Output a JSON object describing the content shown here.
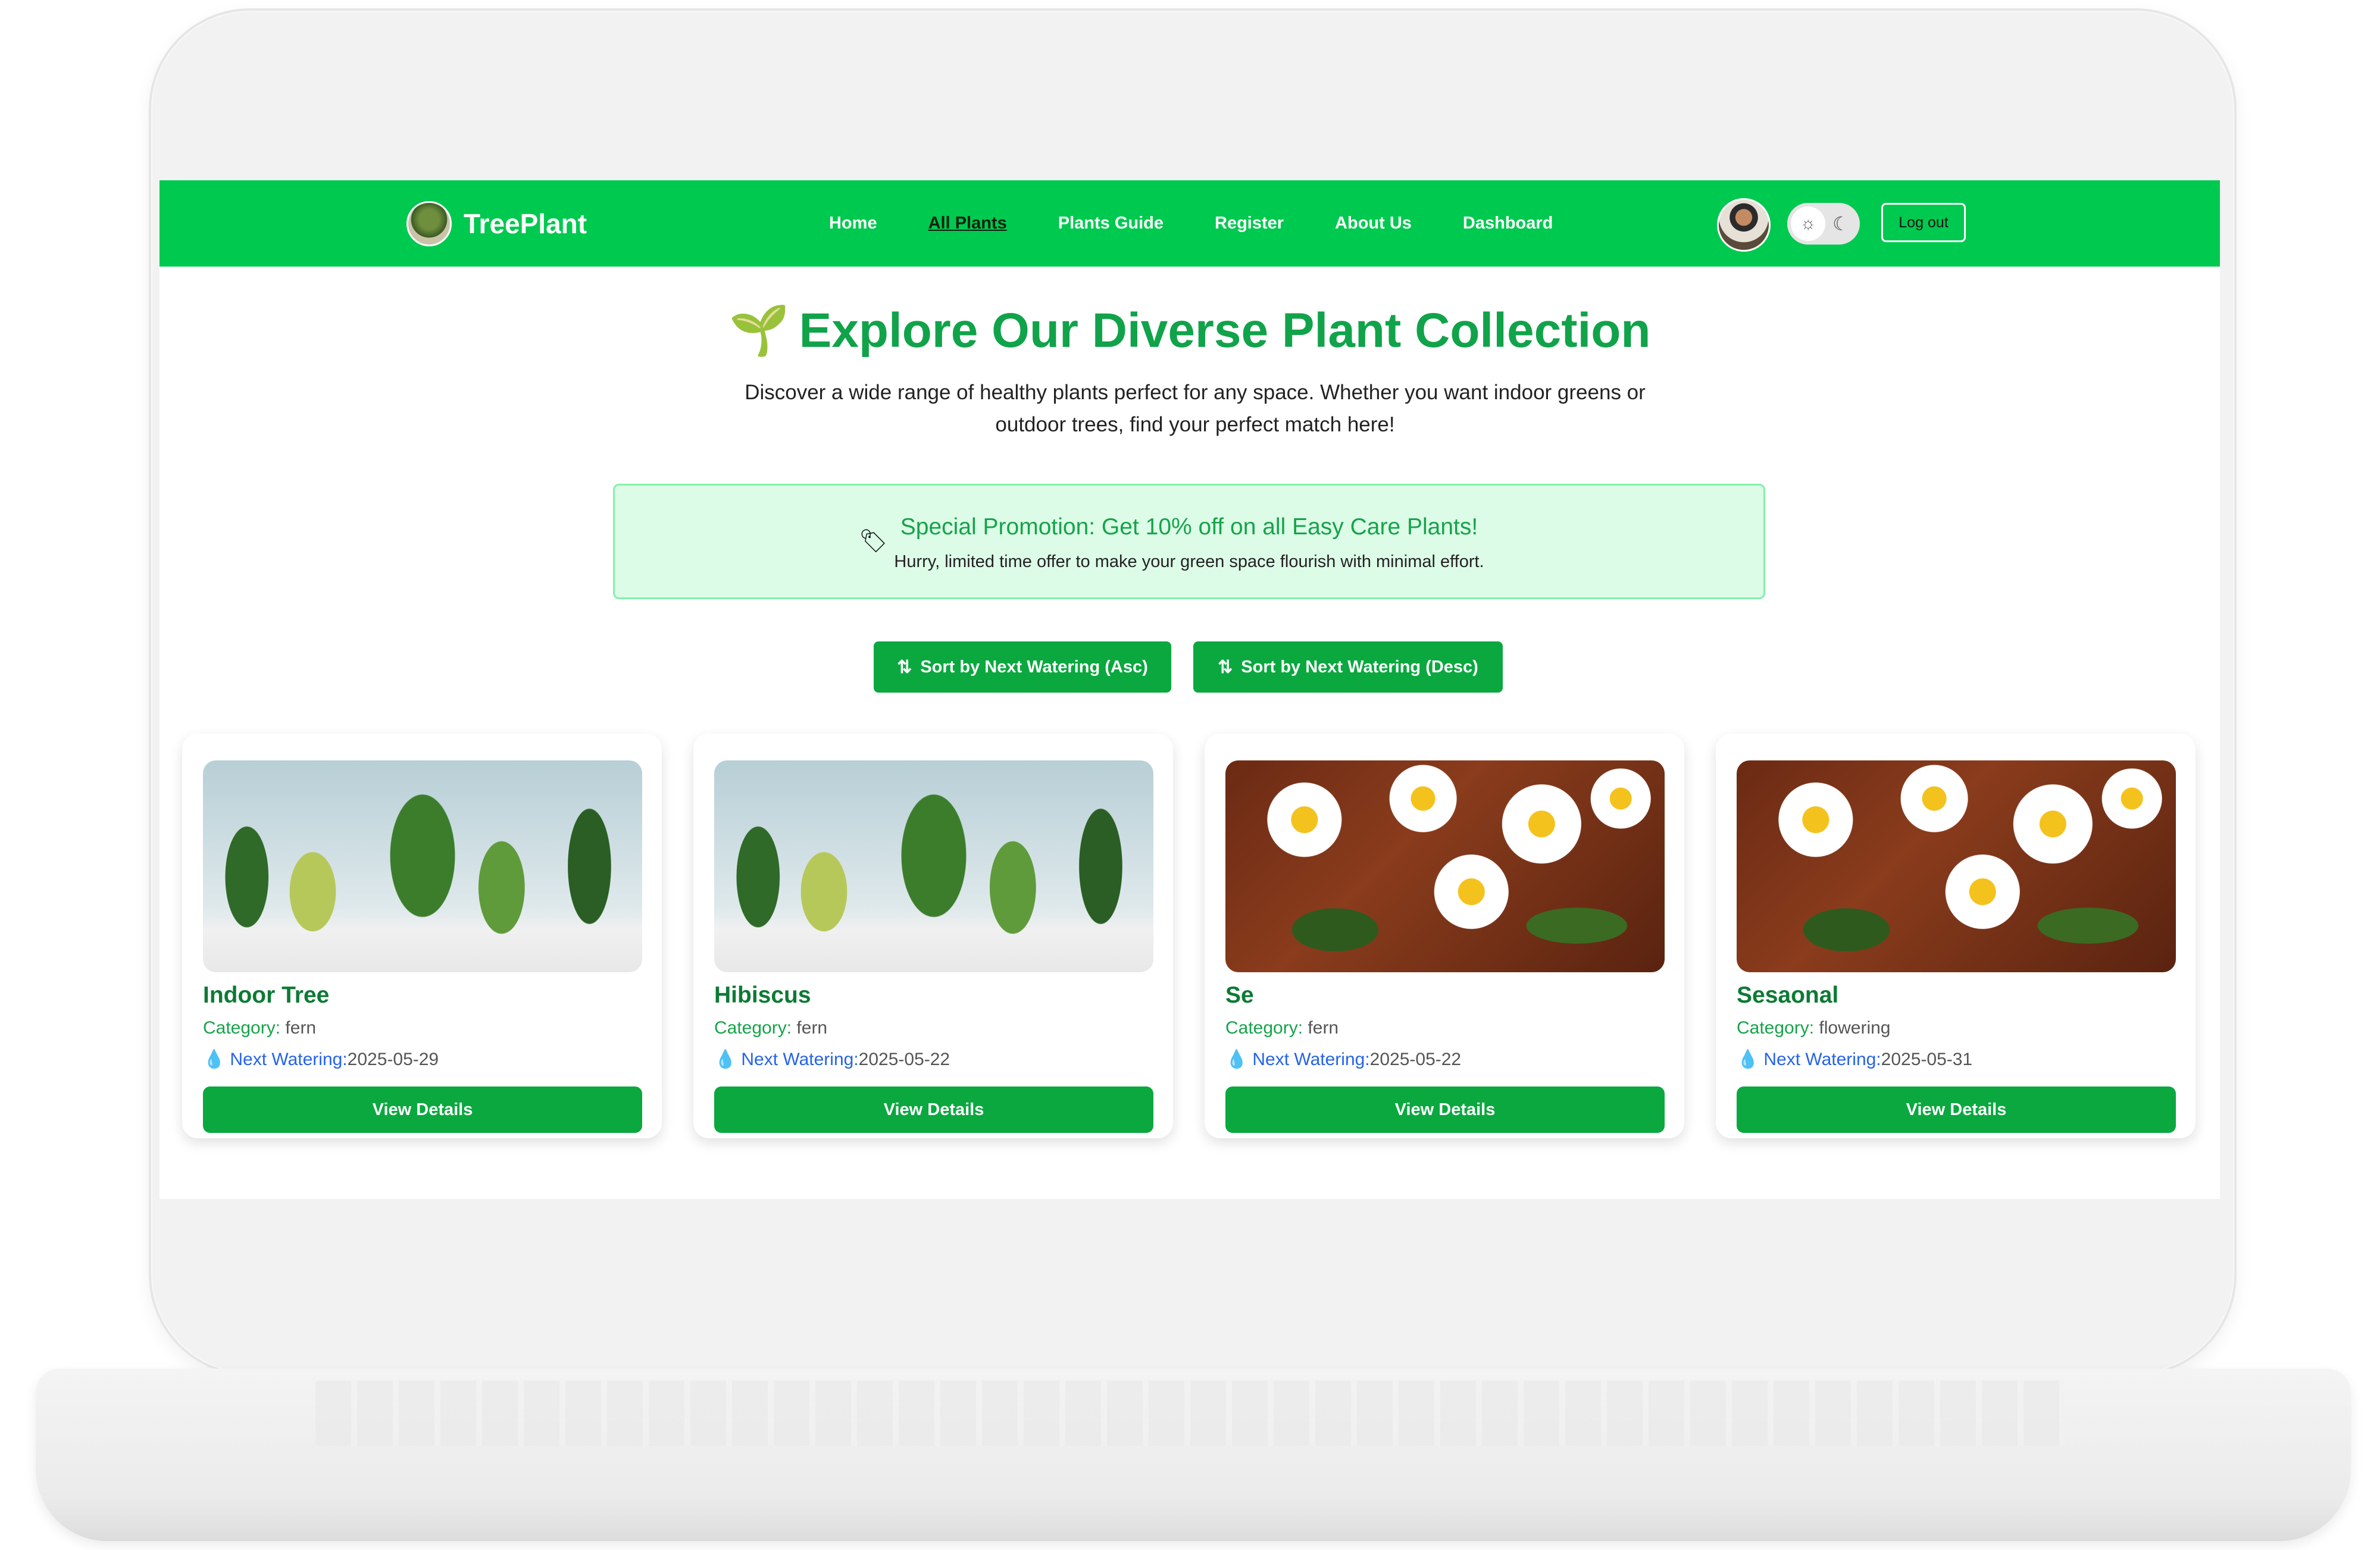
{
  "nav": {
    "brand": "TreePlant",
    "links": [
      "Home",
      "All Plants",
      "Plants Guide",
      "Register",
      "About Us",
      "Dashboard"
    ],
    "active_link": "All Plants",
    "logout_label": "Log out",
    "sun_icon": "☼",
    "moon_icon": "☾"
  },
  "hero": {
    "title": "Explore Our Diverse Plant Collection",
    "sprout_icon": "🌱",
    "subtitle": "Discover a wide range of healthy plants perfect for any space. Whether you want indoor greens or outdoor trees, find your perfect match here!"
  },
  "promo": {
    "tag_icon": "🏷",
    "title": "Special Promotion: Get 10% off on all Easy Care Plants!",
    "subtitle": "Hurry, limited time offer to make your green space flourish with minimal effort."
  },
  "sort": {
    "asc_label": "Sort by Next Watering (Asc)",
    "desc_label": "Sort by Next Watering (Desc)",
    "asc_icon": "⇅",
    "desc_icon": "⇅"
  },
  "cards": [
    {
      "name": "Indoor Tree",
      "category_label": "Category:",
      "category": "fern",
      "water_label": "Next Watering:",
      "next_watering": "2025-05-29",
      "button": "View Details",
      "image": "indoor-plants"
    },
    {
      "name": "Hibiscus",
      "category_label": "Category:",
      "category": "fern",
      "water_label": "Next Watering:",
      "next_watering": "2025-05-22",
      "button": "View Details",
      "image": "indoor-plants"
    },
    {
      "name": "Se",
      "category_label": "Category:",
      "category": "fern",
      "water_label": "Next Watering:",
      "next_watering": "2025-05-22",
      "button": "View Details",
      "image": "daisies"
    },
    {
      "name": "Sesaonal",
      "category_label": "Category:",
      "category": "flowering",
      "water_label": "Next Watering:",
      "next_watering": "2025-05-31",
      "button": "View Details",
      "image": "daisies"
    }
  ],
  "colors": {
    "nav_green": "#00c94f",
    "accent_green": "#11a34a",
    "button_green": "#0aa83f",
    "promo_bg": "#dcfce7",
    "water_blue": "#2563eb"
  }
}
